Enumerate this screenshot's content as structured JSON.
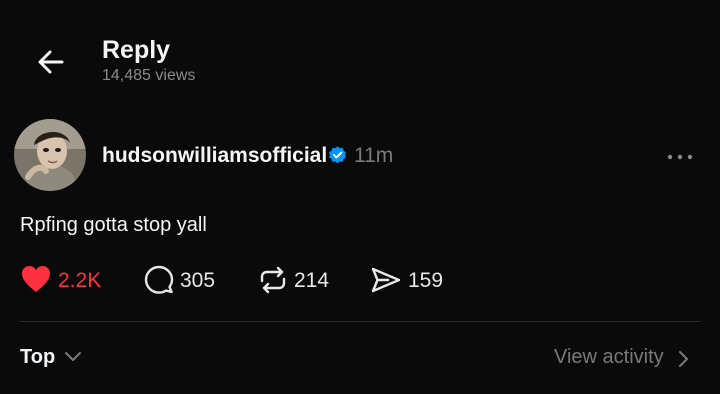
{
  "header": {
    "title": "Reply",
    "views": "14,485 views",
    "back_icon": "arrow-left-icon"
  },
  "post": {
    "username": "hudsonwilliamsofficial",
    "verified_icon": "verified-badge-icon",
    "time": "11m",
    "text": "Rpfing gotta stop yall",
    "actions": {
      "likes": "2.2K",
      "replies": "305",
      "reposts": "214",
      "shares": "159"
    },
    "liked": true
  },
  "footer": {
    "sort_label": "Top",
    "view_activity_label": "View activity"
  },
  "colors": {
    "background": "#0a0a0a",
    "like": "#ff3040",
    "verified": "#0095f6",
    "muted": "#7a7a7a"
  }
}
